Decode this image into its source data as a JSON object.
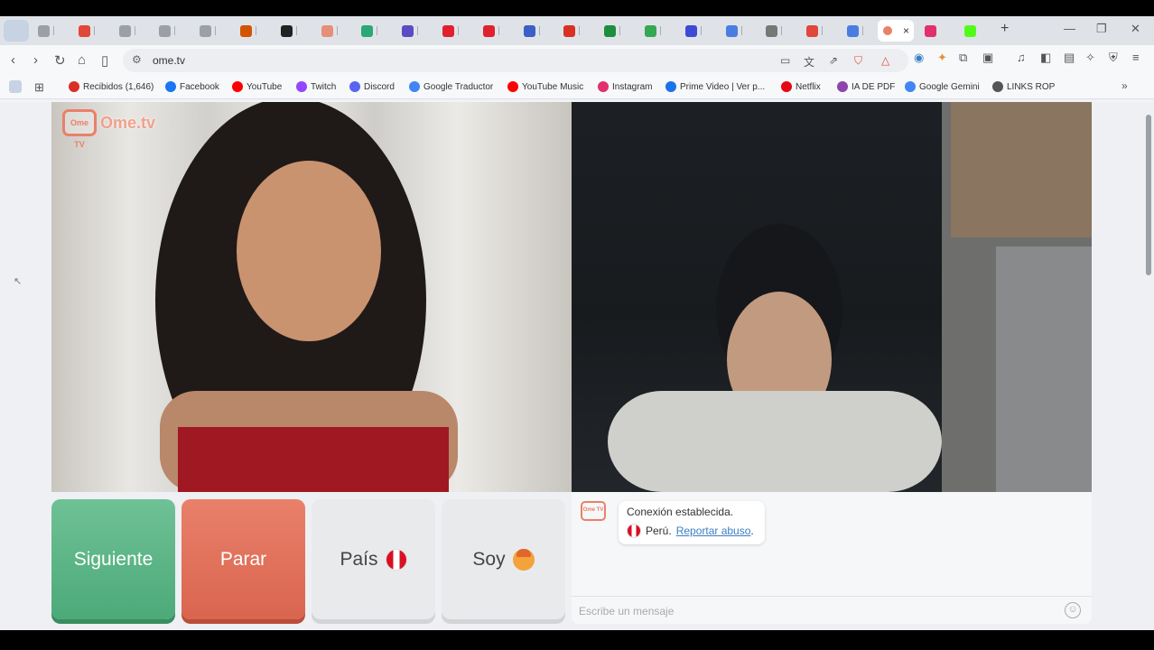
{
  "browser": {
    "active_tab_close": "×",
    "new_tab": "+",
    "window_controls": [
      "—",
      "❐",
      "✕"
    ],
    "url": "ome.tv"
  },
  "tabs": [
    {
      "color": "#9aa0a6"
    },
    {
      "color": "#e0463a"
    },
    {
      "color": "#9aa0a6"
    },
    {
      "color": "#9aa0a6"
    },
    {
      "color": "#9aa0a6"
    },
    {
      "color": "#d35400"
    },
    {
      "color": "#222222"
    },
    {
      "color": "#e58f7a"
    },
    {
      "color": "#2aa876"
    },
    {
      "color": "#5b4cc4"
    },
    {
      "color": "#e0202e"
    },
    {
      "color": "#e0202e"
    },
    {
      "color": "#3b5fc4"
    },
    {
      "color": "#d93025"
    },
    {
      "color": "#1e8e3e"
    },
    {
      "color": "#34a853"
    },
    {
      "color": "#3c4ad6"
    },
    {
      "color": "#4a7de0"
    },
    {
      "color": "#777777"
    },
    {
      "color": "#e0463a"
    },
    {
      "color": "#4a7de0"
    }
  ],
  "bookmarks": [
    {
      "label": "Recibidos (1,646)",
      "color": "#d93025"
    },
    {
      "label": "Facebook",
      "color": "#1877f2"
    },
    {
      "label": "YouTube",
      "color": "#ff0000"
    },
    {
      "label": "Twitch",
      "color": "#9146ff"
    },
    {
      "label": "Discord",
      "color": "#5865f2"
    },
    {
      "label": "Google Traductor",
      "color": "#4285f4"
    },
    {
      "label": "YouTube Music",
      "color": "#ff0000"
    },
    {
      "label": "Instagram",
      "color": "#e1306c"
    },
    {
      "label": "Prime Video | Ver p...",
      "color": "#1a73e8"
    },
    {
      "label": "Netflix",
      "color": "#e50914"
    },
    {
      "label": "IA DE PDF",
      "color": "#8e44ad"
    },
    {
      "label": "Google Gemini",
      "color": "#4285f4"
    },
    {
      "label": "LINKS ROP",
      "color": "#555555"
    }
  ],
  "ome": {
    "logo_name": "Ome.tv",
    "logo_box": "Ome TV",
    "buttons": {
      "next": "Siguiente",
      "stop": "Parar",
      "country": "País",
      "gender": "Soy"
    },
    "chat": {
      "status": "Conexión establecida.",
      "country": "Perú.",
      "report": "Reportar abuso",
      "report_suffix": ".",
      "input_placeholder": "Escribe un mensaje"
    }
  }
}
